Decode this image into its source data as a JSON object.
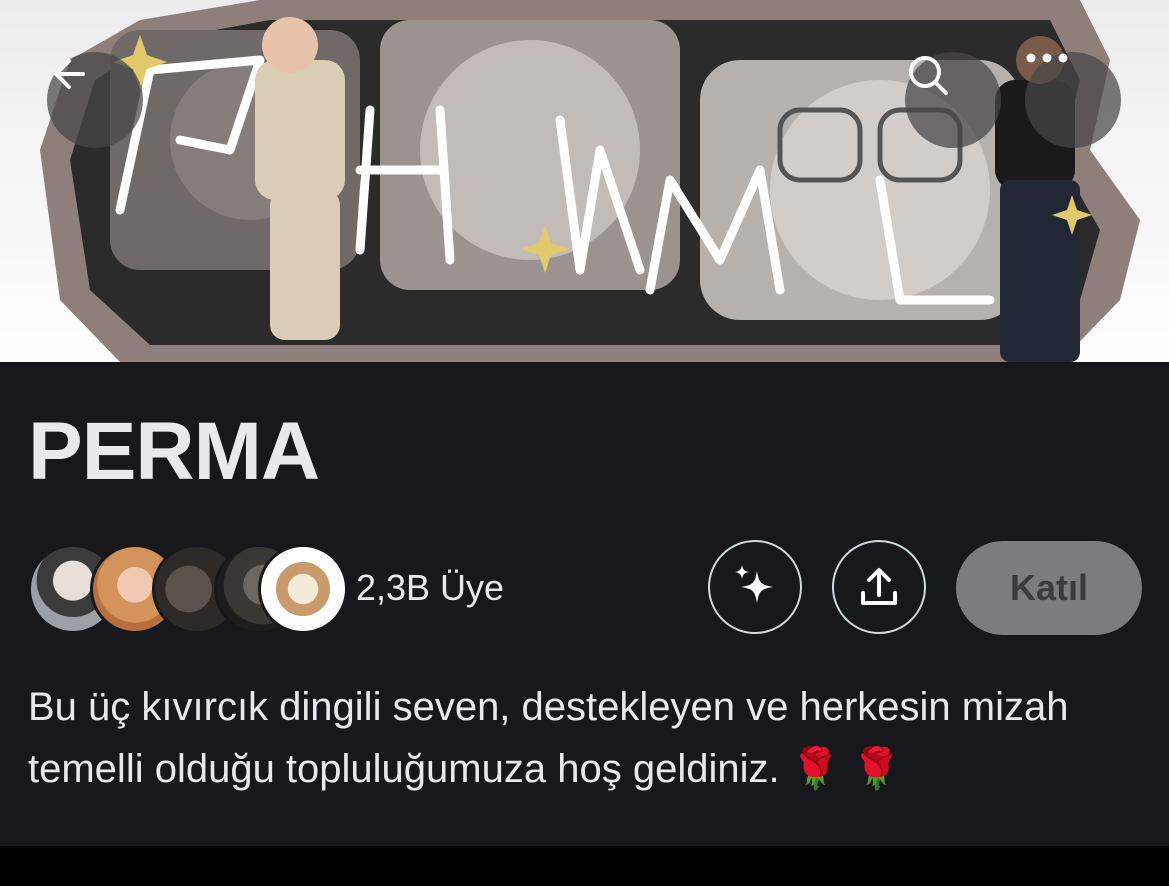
{
  "header": {
    "back_icon": "arrow-left-icon",
    "search_icon": "search-icon",
    "more_icon": "more-horizontal-icon",
    "banner_bg": "#f2f2f2"
  },
  "community": {
    "name": "PERMA",
    "member_count": "2,3B Üye",
    "description": "Bu üç kıvırcık dingili seven, destekleyen ve herkesin mizah temelli olduğu topluluğumuza hoş geldiniz.",
    "emojis": "🌹 🌹"
  },
  "actions": {
    "sparkle_icon": "sparkle-icon",
    "share_icon": "share-icon",
    "join_label": "Katıl"
  },
  "colors": {
    "panel_bg": "#17181c",
    "text": "#e7e9ea",
    "join_bg": "#7b7c7f"
  }
}
